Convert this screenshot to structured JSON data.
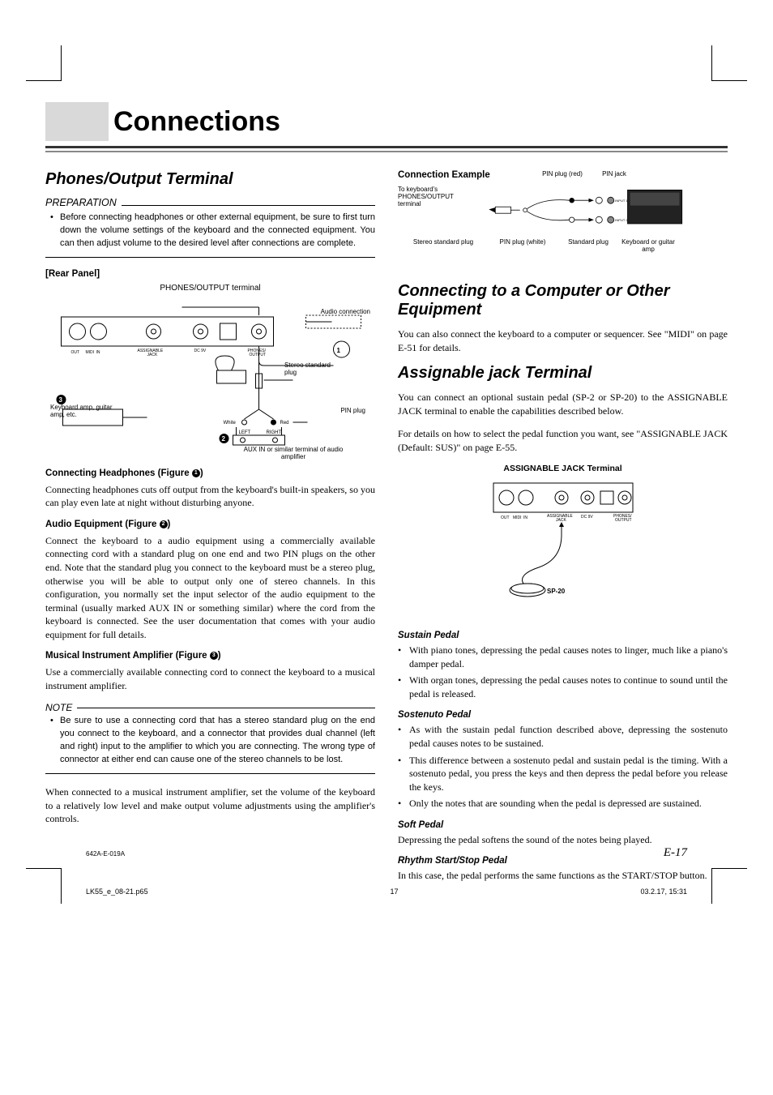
{
  "chapter_title": "Connections",
  "left": {
    "section_title": "Phones/Output Terminal",
    "preparation_label": "PREPARATION",
    "preparation_text": "Before connecting headphones or other external equipment, be sure to first turn down the volume settings of the keyboard and the connected equipment. You can then adjust volume to the desired level after connections are complete.",
    "rear_panel_label": "[Rear Panel]",
    "diagram": {
      "caption": "PHONES/OUTPUT terminal",
      "labels": {
        "audio_connection": "Audio connection",
        "stereo_plug": "Stereo standard plug",
        "pin_plug": "PIN plug",
        "white": "White",
        "red": "Red",
        "left": "LEFT",
        "right": "RIGHT",
        "aux": "AUX IN or similar terminal of audio amplifier",
        "keyboard_amp": "Keyboard amp, guitar amp, etc.",
        "panel_ports": [
          "OUT",
          "MIDI",
          "IN",
          "ASSIGNABLE JACK",
          "DC 9V",
          "PHONES/ OUTPUT"
        ]
      }
    },
    "h_connect_head": "Connecting Headphones (Figure 1)",
    "p_connect_head": "Connecting headphones cuts off output from the keyboard's built-in speakers, so you can play even late at night without disturbing anyone.",
    "h_audio_eq": "Audio Equipment (Figure 2)",
    "p_audio_eq": "Connect the keyboard to a audio equipment using a commercially available connecting cord with a standard plug on one end and two PIN plugs on the other end. Note that the standard plug you connect to the keyboard must be a stereo plug, otherwise you will be able to output only one of stereo channels. In this configuration, you normally set the input selector of the audio equipment to the terminal (usually marked AUX IN or something similar) where the cord from the keyboard is connected. See the user documentation that comes with your audio equipment for full details.",
    "h_amp": "Musical Instrument Amplifier (Figure 3)",
    "p_amp": "Use a commercially available connecting cord to connect the keyboard to a musical instrument amplifier.",
    "note_label": "NOTE",
    "note_text": "Be sure to use a connecting cord that has a stereo standard plug on the end you connect to the keyboard, and a connector that provides dual channel (left and right) input to the amplifier to which you are connecting. The wrong type of connector at either end can cause one of the stereo channels to be lost.",
    "p_tail": "When connected to a musical instrument amplifier, set the volume of the keyboard to a relatively low level and make output volume adjustments using the amplifier's controls."
  },
  "right": {
    "conn_example_label": "Connection Example",
    "conn_example_labels": {
      "pin_red": "PIN plug (red)",
      "pin_jack": "PIN jack",
      "to_keyboard": "To keyboard's PHONES/OUTPUT terminal",
      "stereo_plug": "Stereo standard plug",
      "pin_white": "PIN plug (white)",
      "standard_plug": "Standard plug",
      "kb_amp": "Keyboard or guitar amp",
      "input1": "INPUT 1",
      "input2": "INPUT 2"
    },
    "sec_computer_title": "Connecting to a Computer or Other Equipment",
    "p_computer": "You can also connect the keyboard to a computer or sequencer. See \"MIDI\" on page E-51 for details.",
    "sec_ajack_title": "Assignable jack Terminal",
    "p_ajack1": "You can connect an optional sustain pedal (SP-2 or SP-20) to the ASSIGNABLE JACK terminal to enable the capabilities described below.",
    "p_ajack2": "For details on how to select the pedal function you want, see \"ASSIGNABLE JACK (Default: SUS)\" on page E-55.",
    "ajack_diagram_label": "ASSIGNABLE JACK Terminal",
    "ajack_sp20": "SP-20",
    "ajack_panel_ports": [
      "OUT",
      "MIDI",
      "IN",
      "ASSIGNABLE JACK",
      "DC 9V",
      "PHONES/ OUTPUT"
    ],
    "h_sustain": "Sustain Pedal",
    "sustain_bullets": [
      "With piano tones, depressing the pedal causes notes to linger, much like a piano's damper pedal.",
      "With organ tones, depressing the pedal causes notes to continue to sound until the pedal is released."
    ],
    "h_sost": "Sostenuto Pedal",
    "sost_bullets": [
      "As with the sustain pedal function described above, depressing the sostenuto pedal causes notes to be sustained.",
      "This difference between a sostenuto pedal and sustain pedal is the timing. With a sostenuto pedal, you press the keys and then depress the pedal before you release the keys.",
      "Only the notes that are sounding when the pedal is depressed are sustained."
    ],
    "h_soft": "Soft Pedal",
    "p_soft": "Depressing the pedal softens the sound of the notes being played.",
    "h_rhythm": "Rhythm Start/Stop Pedal",
    "p_rhythm": "In this case, the pedal performs the same functions as the START/STOP button."
  },
  "footer": {
    "code": "642A-E-019A",
    "page": "E-17",
    "p65_file": "LK55_e_08-21.p65",
    "p65_page": "17",
    "p65_date": "03.2.17, 15:31"
  }
}
